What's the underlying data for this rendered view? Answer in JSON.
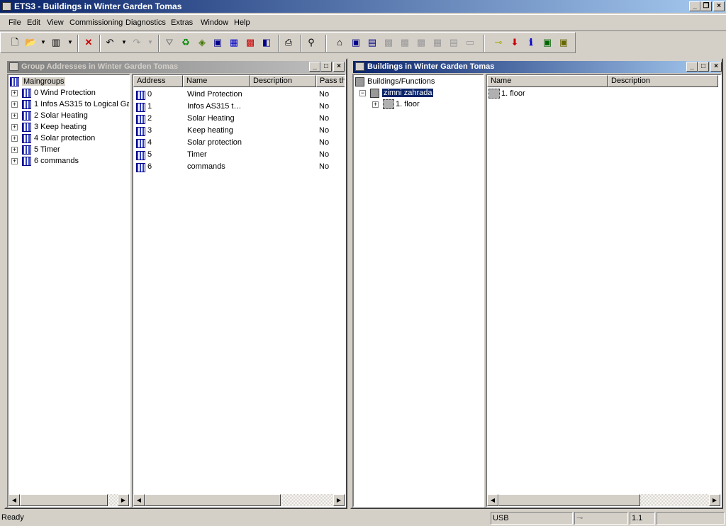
{
  "app": {
    "title": "ETS3 - Buildings in Winter Garden Tomas"
  },
  "menu": [
    "File",
    "Edit",
    "View",
    "Commissioning",
    "Diagnostics",
    "Extras",
    "Window",
    "Help"
  ],
  "toolbar_icons": [
    "new-icon",
    "open-icon",
    "library-icon",
    "delete-icon",
    "undo-icon",
    "redo-icon",
    "filter-icon",
    "refresh-icon",
    "tag-icon",
    "window1-icon",
    "table-icon",
    "group-icon",
    "window2-icon",
    "print-icon",
    "find-icon",
    "add-building-icon",
    "add-room-icon",
    "add-function-icon",
    "tb-grey1-icon",
    "tb-grey2-icon",
    "tb-grey3-icon",
    "tb-grey4-icon",
    "tb-grey5-icon",
    "tb-grey6-icon",
    "connect-icon",
    "download-icon",
    "info-icon",
    "monitor-icon",
    "bus-icon"
  ],
  "group_window": {
    "title": "Group Addresses in Winter Garden Tomas",
    "tree_root": "Maingroups",
    "tree": [
      "0 Wind Protection",
      "1 Infos AS315 to Logical Ga",
      "2 Solar Heating",
      "3 Keep heating",
      "4 Solar protection",
      "5 Timer",
      "6 commands"
    ],
    "columns": [
      "Address",
      "Name",
      "Description",
      "Pass th"
    ],
    "rows": [
      [
        "0",
        "Wind Protection",
        "",
        "No"
      ],
      [
        "1",
        "Infos AS315 t…",
        "",
        "No"
      ],
      [
        "2",
        "Solar Heating",
        "",
        "No"
      ],
      [
        "3",
        "Keep heating",
        "",
        "No"
      ],
      [
        "4",
        "Solar protection",
        "",
        "No"
      ],
      [
        "5",
        "Timer",
        "",
        "No"
      ],
      [
        "6",
        "commands",
        "",
        "No"
      ]
    ]
  },
  "buildings_window": {
    "title": "Buildings in Winter Garden Tomas",
    "tree_root": "Buildings/Functions",
    "building": "zimni zahrada",
    "floor": "1. floor",
    "columns": [
      "Name",
      "Description"
    ],
    "rows": [
      "1. floor"
    ]
  },
  "status": {
    "text": "Ready",
    "interface": "USB",
    "address": "1.1"
  },
  "colors": {
    "active_caption": "#0a246a",
    "inactive_caption": "#808080",
    "selection": "#0a246a"
  }
}
